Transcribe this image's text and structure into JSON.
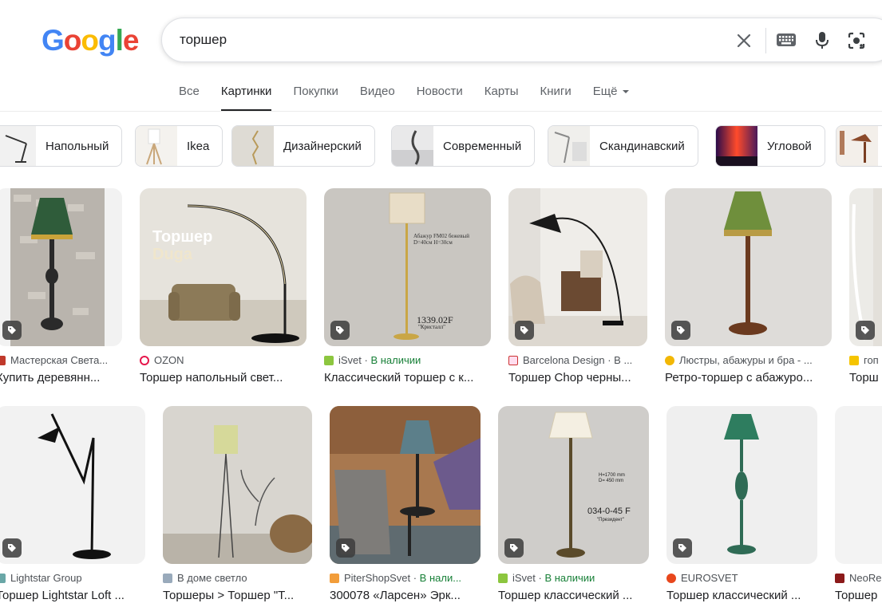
{
  "logo": {
    "letters": [
      "G",
      "o",
      "o",
      "g",
      "l",
      "e"
    ],
    "colors": [
      "#4285F4",
      "#EA4335",
      "#FBBC05",
      "#4285F4",
      "#34A853",
      "#EA4335"
    ]
  },
  "search": {
    "query": "торшер"
  },
  "icons": {
    "clear": "close-icon",
    "keyboard": "keyboard-icon",
    "mic": "mic-icon",
    "lens": "lens-icon"
  },
  "tabs": [
    "Все",
    "Картинки",
    "Покупки",
    "Видео",
    "Новости",
    "Карты",
    "Книги",
    "Ещё"
  ],
  "active_tab": "Картинки",
  "chips": [
    "Напольный",
    "Ikea",
    "Дизайнерский",
    "Современный",
    "Скандинавский",
    "Угловой"
  ],
  "results_row1": [
    {
      "source": "Мастерская Света...",
      "title": "Купить деревянн..."
    },
    {
      "source": "OZON",
      "title": "Торшер напольный свет..."
    },
    {
      "source": "iSvet",
      "availability": "В наличии",
      "title": "Классический торшер с к..."
    },
    {
      "source": "Barcelona Design · В ...",
      "title": "Торшер Chop черны..."
    },
    {
      "source": "Люстры, абажуры и бра - ...",
      "title": "Ретро-торшер с абажуро..."
    },
    {
      "source": "гоп",
      "title": "Торш"
    }
  ],
  "results_row2": [
    {
      "source": "Lightstar Group",
      "title": "Торшер Lightstar Loft ..."
    },
    {
      "source": "В доме светло",
      "title": "Торшеры > Торшер \"Т..."
    },
    {
      "source": "PiterShopSvet",
      "availability": "В нали...",
      "title": "300078 «Ларсен» Эрк..."
    },
    {
      "source": "iSvet",
      "availability": "В наличии",
      "title": "Торшер классический ..."
    },
    {
      "source": "EUROSVET",
      "title": "Торшер классический ..."
    },
    {
      "source": "NeoRe",
      "title": "Торшер"
    }
  ],
  "image_text": {
    "duga_title": "Торшер",
    "duga_sub": "Duga",
    "price_1": "1339.02F",
    "price_1_sub": "\"Кристалл\"",
    "spec_1": "Абажур FM02 бежевый",
    "spec_2": "D=40см H=30см",
    "size_1": "H=1700 mm",
    "size_2": "D= 450 mm",
    "code_2": "034-0-45 F",
    "code_2_sub": "\"Президент\""
  }
}
